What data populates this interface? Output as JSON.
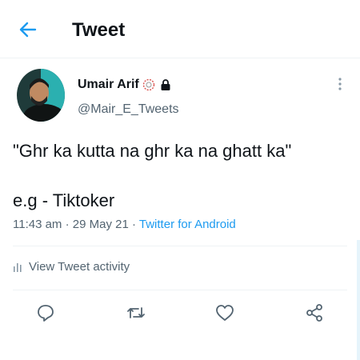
{
  "header": {
    "title": "Tweet"
  },
  "author": {
    "name": "Umair Arif",
    "handle": "@Mair_E_Tweets"
  },
  "tweet": {
    "line1": "\"Ghr ka kutta na ghr ka na ghatt ka\"",
    "line2": "e.g  - Tiktoker",
    "time": "11:43 am",
    "dot1": " · ",
    "date": "29 May 21",
    "dot2": " · ",
    "source": "Twitter for Android"
  },
  "activity": {
    "label": "View Tweet activity"
  },
  "colors": {
    "accent": "#1d9bf0",
    "text": "#0f1419",
    "muted": "#536471"
  }
}
